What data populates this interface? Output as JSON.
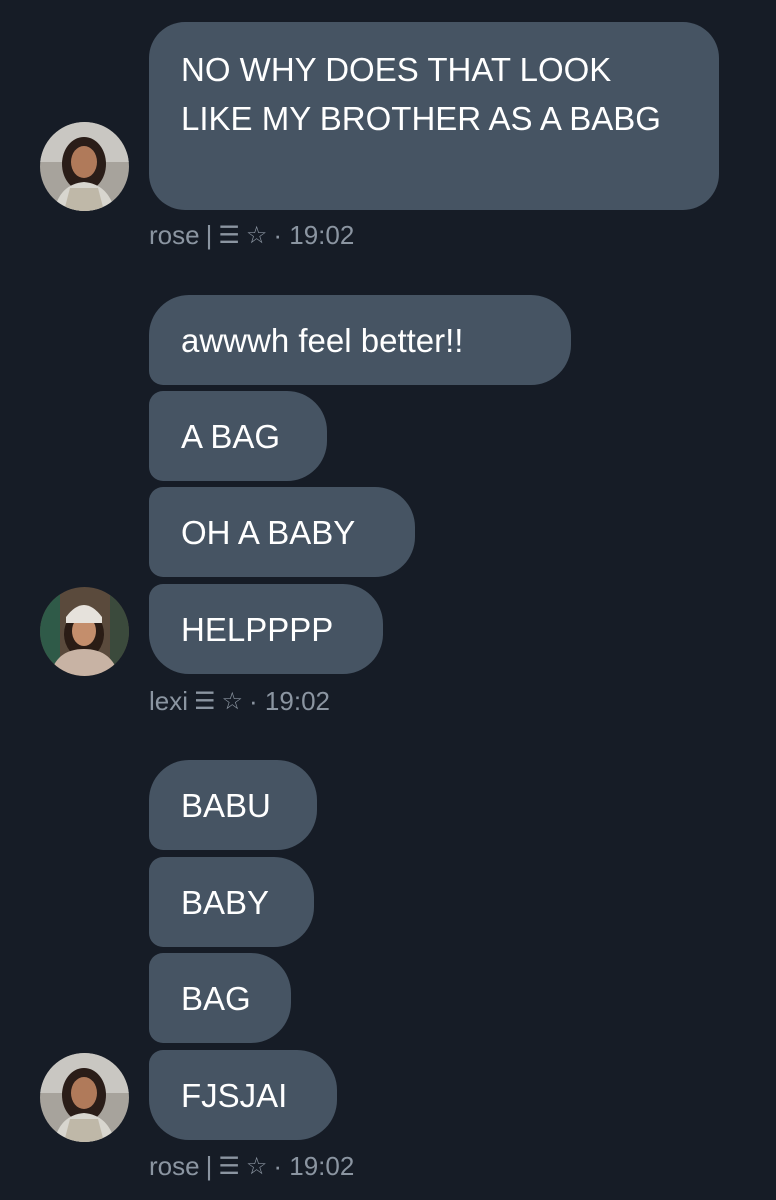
{
  "groups": [
    {
      "sender": "rose",
      "separator": "|",
      "time": "· 19:02",
      "messages": [
        "NO WHY DOES THAT LOOK LIKE MY BROTHER AS A BABG"
      ]
    },
    {
      "sender": "lexi",
      "separator": "",
      "time": "· 19:02",
      "messages": [
        "awwwh feel better!!",
        "A BAG",
        "OH A BABY",
        "HELPPPP"
      ]
    },
    {
      "sender": "rose",
      "separator": "|",
      "time": "· 19:02",
      "messages": [
        "BABU",
        "BABY",
        "BAG",
        "FJSJAI"
      ]
    }
  ],
  "icons": {
    "role": "menu-lines-icon",
    "star": "star-outline-icon"
  },
  "colors": {
    "background": "#161c26",
    "bubble": "#465463",
    "meta_text": "#8b95a1"
  }
}
